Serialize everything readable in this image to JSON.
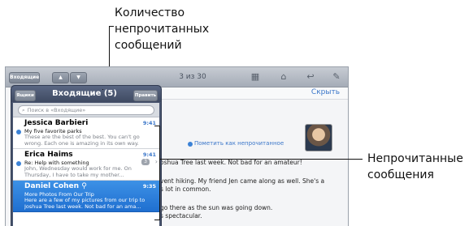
{
  "callouts": {
    "unread_count": [
      "Количество",
      "непрочитанных",
      "сообщений"
    ],
    "unread_messages": [
      "Непрочитанные",
      "сообщения"
    ]
  },
  "toolbar": {
    "inbox_button": "Входящие",
    "counter": "3 из 30",
    "icons": [
      "up-arrow",
      "down-arrow",
      "folder-move",
      "trash",
      "reply",
      "compose"
    ]
  },
  "message": {
    "hide_link": "Скрыть",
    "mark_unread": "Пометить как непрочитанное",
    "body_lines": [
      "oshua Tree last week. Not bad for an amateur!",
      "vent hiking. My friend Jen came along as well. She's a",
      "s lot in common.",
      "go there as the sun was going down.",
      "s spectacular."
    ]
  },
  "popover": {
    "mailboxes_button": "Ящики",
    "title": "Входящие (5)",
    "edit_button": "Править",
    "search_placeholder": "Поиск в «Входящие»",
    "messages": [
      {
        "sender": "Jessica Barbieri",
        "time": "9:41",
        "subject": "My five favorite parks",
        "preview": "These are the best of the best. You can't go wrong. Each one is amazing in its own way.",
        "unread": true,
        "selected": false,
        "thread_count": ""
      },
      {
        "sender": "Erica Haims",
        "time": "9:41",
        "subject": "Re: Help with something",
        "preview": "John, Wednesday would work for me. On Thursday, I have to take my mother...",
        "unread": true,
        "selected": false,
        "thread_count": "3"
      },
      {
        "sender": "Daniel Cohen",
        "time": "9:35",
        "subject": "More Photos From Our Trip",
        "preview": "Here are a few of my pictures from our trip to Joshua Tree last week. Not bad for an ama...",
        "unread": false,
        "selected": true,
        "thread_count": ""
      }
    ]
  }
}
